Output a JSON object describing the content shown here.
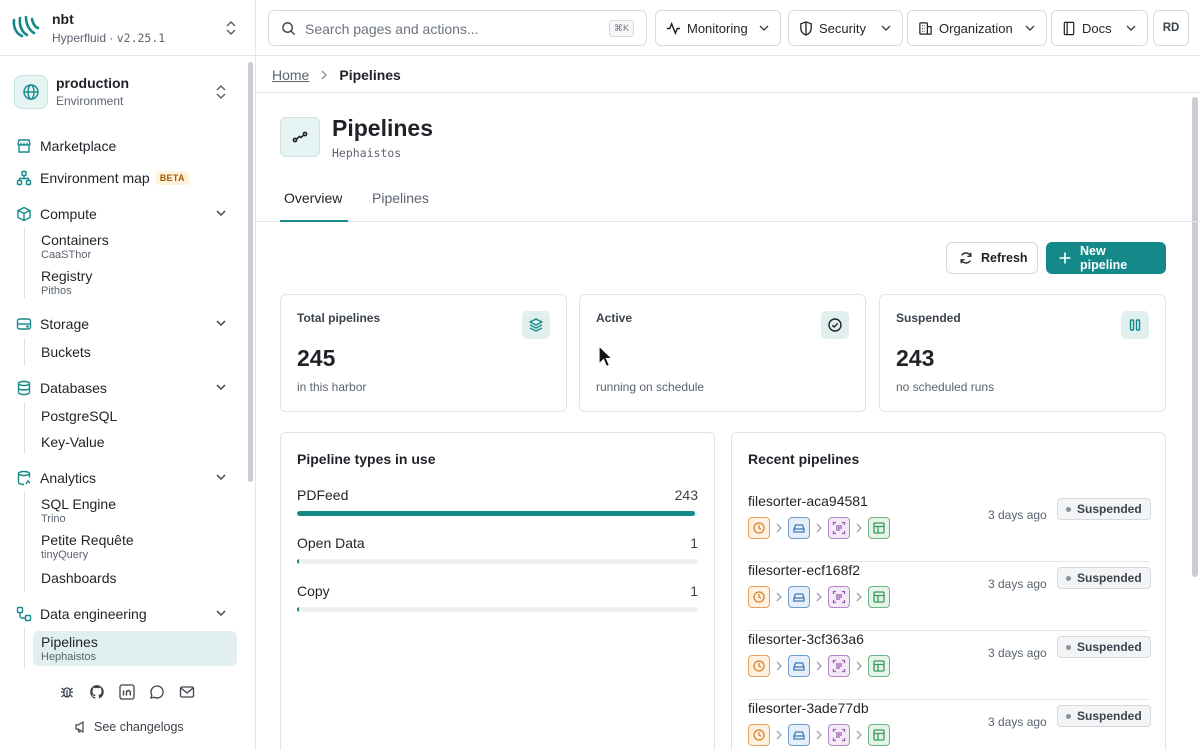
{
  "app": {
    "name": "nbt",
    "org": "Hyperfluid",
    "sep": "·",
    "version": "v2.25.1"
  },
  "environment": {
    "name": "production",
    "label": "Environment"
  },
  "sidebar": {
    "items": [
      {
        "label": "Marketplace",
        "icon": "store-icon"
      },
      {
        "label": "Environment map",
        "badge": "BETA",
        "icon": "network-icon"
      },
      {
        "label": "Compute",
        "icon": "box-icon",
        "children": [
          {
            "label": "Containers",
            "sub": "CaaSThor"
          },
          {
            "label": "Registry",
            "sub": "Pithos"
          }
        ]
      },
      {
        "label": "Storage",
        "icon": "drive-icon",
        "children": [
          {
            "label": "Buckets"
          }
        ]
      },
      {
        "label": "Databases",
        "icon": "database-icon",
        "children": [
          {
            "label": "PostgreSQL"
          },
          {
            "label": "Key-Value"
          }
        ]
      },
      {
        "label": "Analytics",
        "icon": "analytics-icon",
        "children": [
          {
            "label": "SQL Engine",
            "sub": "Trino"
          },
          {
            "label": "Petite Requête",
            "sub": "tinyQuery"
          },
          {
            "label": "Dashboards"
          }
        ]
      },
      {
        "label": "Data engineering",
        "icon": "workflow-icon",
        "children": [
          {
            "label": "Pipelines",
            "sub": "Hephaistos",
            "active": true
          }
        ]
      }
    ],
    "footer": {
      "changelog": "See changelogs",
      "icons": [
        "bug-icon",
        "github-icon",
        "linkedin-icon",
        "chat-icon",
        "mail-icon"
      ]
    }
  },
  "topbar": {
    "search_placeholder": "Search pages and actions...",
    "shortcut": "⌘K",
    "menus": [
      "Monitoring",
      "Security",
      "Organization",
      "Docs"
    ],
    "avatar": "RD"
  },
  "breadcrumb": {
    "home": "Home",
    "current": "Pipelines"
  },
  "page": {
    "title": "Pipelines",
    "subtitle": "Hephaistos",
    "tabs": [
      "Overview",
      "Pipelines"
    ],
    "active_tab": "Overview",
    "refresh": "Refresh",
    "new": "New pipeline"
  },
  "stats": [
    {
      "label": "Total pipelines",
      "value": "245",
      "sub": "in this harbor",
      "icon": "layers-icon"
    },
    {
      "label": "Active",
      "value": "",
      "sub": "running on schedule",
      "icon": "check-circle-icon"
    },
    {
      "label": "Suspended",
      "value": "243",
      "sub": "no scheduled runs",
      "icon": "pause-icon"
    }
  ],
  "types": {
    "title": "Pipeline types in use",
    "total": 245,
    "rows": [
      {
        "name": "PDFeed",
        "count": 243
      },
      {
        "name": "Open Data",
        "count": 1
      },
      {
        "name": "Copy",
        "count": 1
      }
    ]
  },
  "recent": {
    "title": "Recent pipelines",
    "rows": [
      {
        "name": "filesorter-aca94581",
        "ago": "3 days ago",
        "status": "Suspended"
      },
      {
        "name": "filesorter-ecf168f2",
        "ago": "3 days ago",
        "status": "Suspended"
      },
      {
        "name": "filesorter-3cf363a6",
        "ago": "3 days ago",
        "status": "Suspended"
      },
      {
        "name": "filesorter-3ade77db",
        "ago": "3 days ago",
        "status": "Suspended"
      }
    ]
  },
  "colors": {
    "accent": "#15898a",
    "accent_soft": "#e2efef",
    "border": "#e3e6ea"
  }
}
